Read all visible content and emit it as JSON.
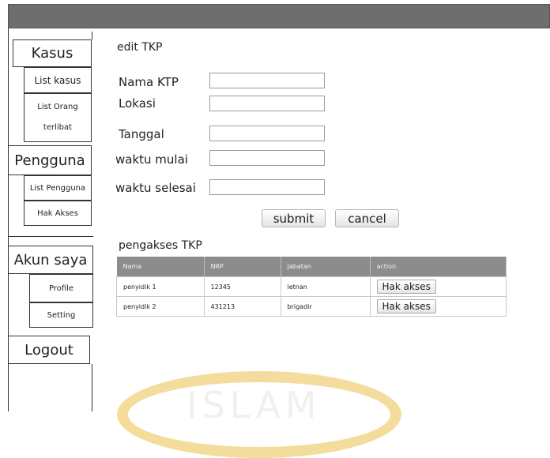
{
  "sidebar": {
    "kasus": "Kasus",
    "list_kasus": "List kasus",
    "list_orang_1": "List Orang",
    "list_orang_2": "terlibat",
    "pengguna": "Pengguna",
    "list_pengguna": "List Pengguna",
    "hak_akses": "Hak Akses",
    "akun_saya": "Akun saya",
    "profile": "Profile",
    "setting": "Setting",
    "logout": "Logout"
  },
  "form": {
    "title": "edit TKP",
    "fields": [
      {
        "label": "Nama KTP",
        "value": ""
      },
      {
        "label": "Lokasi",
        "value": ""
      },
      {
        "label": "Tanggal",
        "value": ""
      },
      {
        "label": "waktu mulai",
        "value": ""
      },
      {
        "label": "waktu selesai",
        "value": ""
      }
    ],
    "submit": "submit",
    "cancel": "cancel"
  },
  "pengakses": {
    "title": "pengakses TKP",
    "headers": [
      "Nama",
      "NRP",
      "Jabatan",
      "action"
    ],
    "rows": [
      {
        "nama": "penyidik 1",
        "nrp": "12345",
        "jabatan": "letnan",
        "action": "Hak akses"
      },
      {
        "nama": "penyidik 2",
        "nrp": "431213",
        "jabatan": "brigadir",
        "action": "Hak akses"
      }
    ]
  },
  "colors": {
    "topbar": "#6e6e6e",
    "table_header": "#8c8c8c",
    "watermark": "#f3dc9c"
  }
}
